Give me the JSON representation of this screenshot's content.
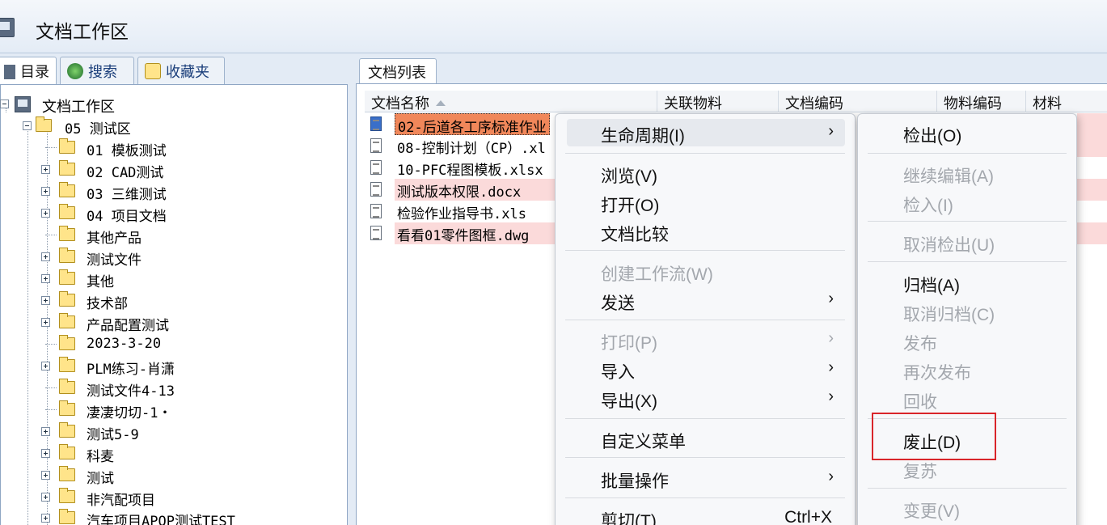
{
  "window": {
    "title": "文档工作区"
  },
  "left_tabs": [
    {
      "label": "目录"
    },
    {
      "label": "搜索"
    },
    {
      "label": "收藏夹"
    }
  ],
  "tree": {
    "root": "文档工作区",
    "items": [
      {
        "label": "05 测试区"
      },
      {
        "label": "01 模板测试"
      },
      {
        "label": "02 CAD测试"
      },
      {
        "label": "03 三维测试"
      },
      {
        "label": "04 项目文档"
      },
      {
        "label": "其他产品"
      },
      {
        "label": "测试文件"
      },
      {
        "label": "其他"
      },
      {
        "label": "技术部"
      },
      {
        "label": "产品配置测试"
      },
      {
        "label": "2023-3-20"
      },
      {
        "label": "PLM练习-肖潇"
      },
      {
        "label": "测试文件4-13"
      },
      {
        "label": "凄凄切切-1・"
      },
      {
        "label": "测试5-9"
      },
      {
        "label": "科麦"
      },
      {
        "label": "测试"
      },
      {
        "label": "非汽配项目"
      },
      {
        "label": "汽车项目APQP测试TEST"
      }
    ]
  },
  "doc_list": {
    "tab_label": "文档列表",
    "columns": [
      "文档名称",
      "关联物料",
      "文档编码",
      "物料编码",
      "材料"
    ],
    "rows": [
      {
        "name": "02-后道各工序标准作业",
        "icon": "excel-file-icon"
      },
      {
        "name": "08-控制计划（CP）.xl",
        "icon": "document-file-icon"
      },
      {
        "name": "10-PFC程图模板.xlsx",
        "icon": "document-file-icon"
      },
      {
        "name": "测试版本权限.docx",
        "icon": "document-file-icon"
      },
      {
        "name": "检验作业指导书.xls",
        "icon": "drawing-file-icon"
      },
      {
        "name": "看看01零件图框.dwg",
        "icon": "drawing-file-icon"
      }
    ]
  },
  "context_menu": {
    "items": [
      {
        "label": "生命周期(I)",
        "submenu": true,
        "disabled": false
      },
      {
        "label": "浏览(V)",
        "disabled": false
      },
      {
        "label": "打开(O)",
        "disabled": false
      },
      {
        "label": "文档比较",
        "disabled": false
      },
      {
        "label": "创建工作流(W)",
        "disabled": true
      },
      {
        "label": "发送",
        "submenu": true,
        "disabled": false
      },
      {
        "label": "打印(P)",
        "submenu": true,
        "disabled": true
      },
      {
        "label": "导入",
        "submenu": true,
        "disabled": false
      },
      {
        "label": "导出(X)",
        "submenu": true,
        "disabled": false
      },
      {
        "label": "自定义菜单",
        "disabled": false
      },
      {
        "label": "批量操作",
        "submenu": true,
        "disabled": false
      },
      {
        "label": "剪切(T)",
        "accel": "Ctrl+X",
        "disabled": false
      }
    ]
  },
  "submenu": {
    "items": [
      {
        "label": "检出(O)",
        "disabled": false
      },
      {
        "label": "继续编辑(A)",
        "disabled": true
      },
      {
        "label": "检入(I)",
        "disabled": true
      },
      {
        "label": "取消检出(U)",
        "disabled": true
      },
      {
        "label": "归档(A)",
        "disabled": false
      },
      {
        "label": "取消归档(C)",
        "disabled": true
      },
      {
        "label": "发布",
        "disabled": true
      },
      {
        "label": "再次发布",
        "disabled": true
      },
      {
        "label": "回收",
        "disabled": true
      },
      {
        "label": "废止(D)",
        "disabled": false
      },
      {
        "label": "复苏",
        "disabled": true
      },
      {
        "label": "变更(V)",
        "disabled": true
      }
    ]
  },
  "colors": {
    "selection": "#f0875a",
    "row_pink": "#fbdada",
    "annotation": "#d9252a"
  }
}
